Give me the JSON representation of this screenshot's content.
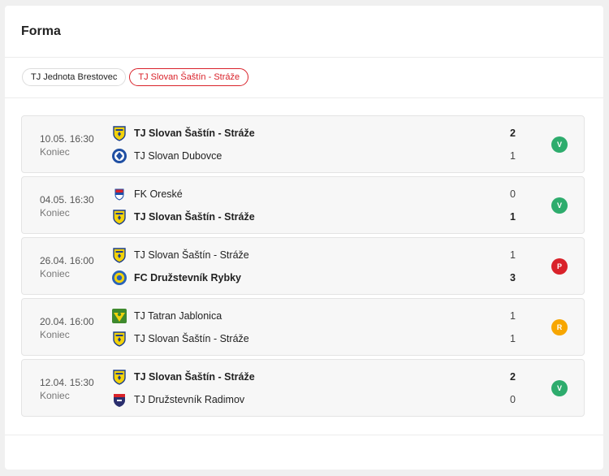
{
  "title": "Forma",
  "tabs": [
    {
      "label": "TJ Jednota Brestovec",
      "active": false
    },
    {
      "label": "TJ Slovan Šaštín - Stráže",
      "active": true
    }
  ],
  "matches": [
    {
      "date": "10.05. 16:30",
      "status": "Koniec",
      "home": {
        "name": "TJ Slovan Šaštín - Stráže",
        "crest": "slovan-sastin-crest",
        "score": "2",
        "bold": true
      },
      "away": {
        "name": "TJ Slovan Dubovce",
        "crest": "slovan-dubovce-crest",
        "score": "1",
        "bold": false
      },
      "result": {
        "label": "V",
        "kind": "win"
      }
    },
    {
      "date": "04.05. 16:30",
      "status": "Koniec",
      "home": {
        "name": "FK Oreské",
        "crest": "fk-oreske-crest",
        "score": "0",
        "bold": false
      },
      "away": {
        "name": "TJ Slovan Šaštín - Stráže",
        "crest": "slovan-sastin-crest",
        "score": "1",
        "bold": true
      },
      "result": {
        "label": "V",
        "kind": "win"
      }
    },
    {
      "date": "26.04. 16:00",
      "status": "Koniec",
      "home": {
        "name": "TJ Slovan Šaštín - Stráže",
        "crest": "slovan-sastin-crest",
        "score": "1",
        "bold": false
      },
      "away": {
        "name": "FC Družstevník Rybky",
        "crest": "fc-rybky-crest",
        "score": "3",
        "bold": true
      },
      "result": {
        "label": "P",
        "kind": "loss"
      }
    },
    {
      "date": "20.04. 16:00",
      "status": "Koniec",
      "home": {
        "name": "TJ Tatran Jablonica",
        "crest": "tatran-jablonica-crest",
        "score": "1",
        "bold": false
      },
      "away": {
        "name": "TJ Slovan Šaštín - Stráže",
        "crest": "slovan-sastin-crest",
        "score": "1",
        "bold": false
      },
      "result": {
        "label": "R",
        "kind": "draw"
      }
    },
    {
      "date": "12.04. 15:30",
      "status": "Koniec",
      "home": {
        "name": "TJ Slovan Šaštín - Stráže",
        "crest": "slovan-sastin-crest",
        "score": "2",
        "bold": true
      },
      "away": {
        "name": "TJ Družstevník Radimov",
        "crest": "radimov-crest",
        "score": "0",
        "bold": false
      },
      "result": {
        "label": "V",
        "kind": "win"
      }
    }
  ]
}
